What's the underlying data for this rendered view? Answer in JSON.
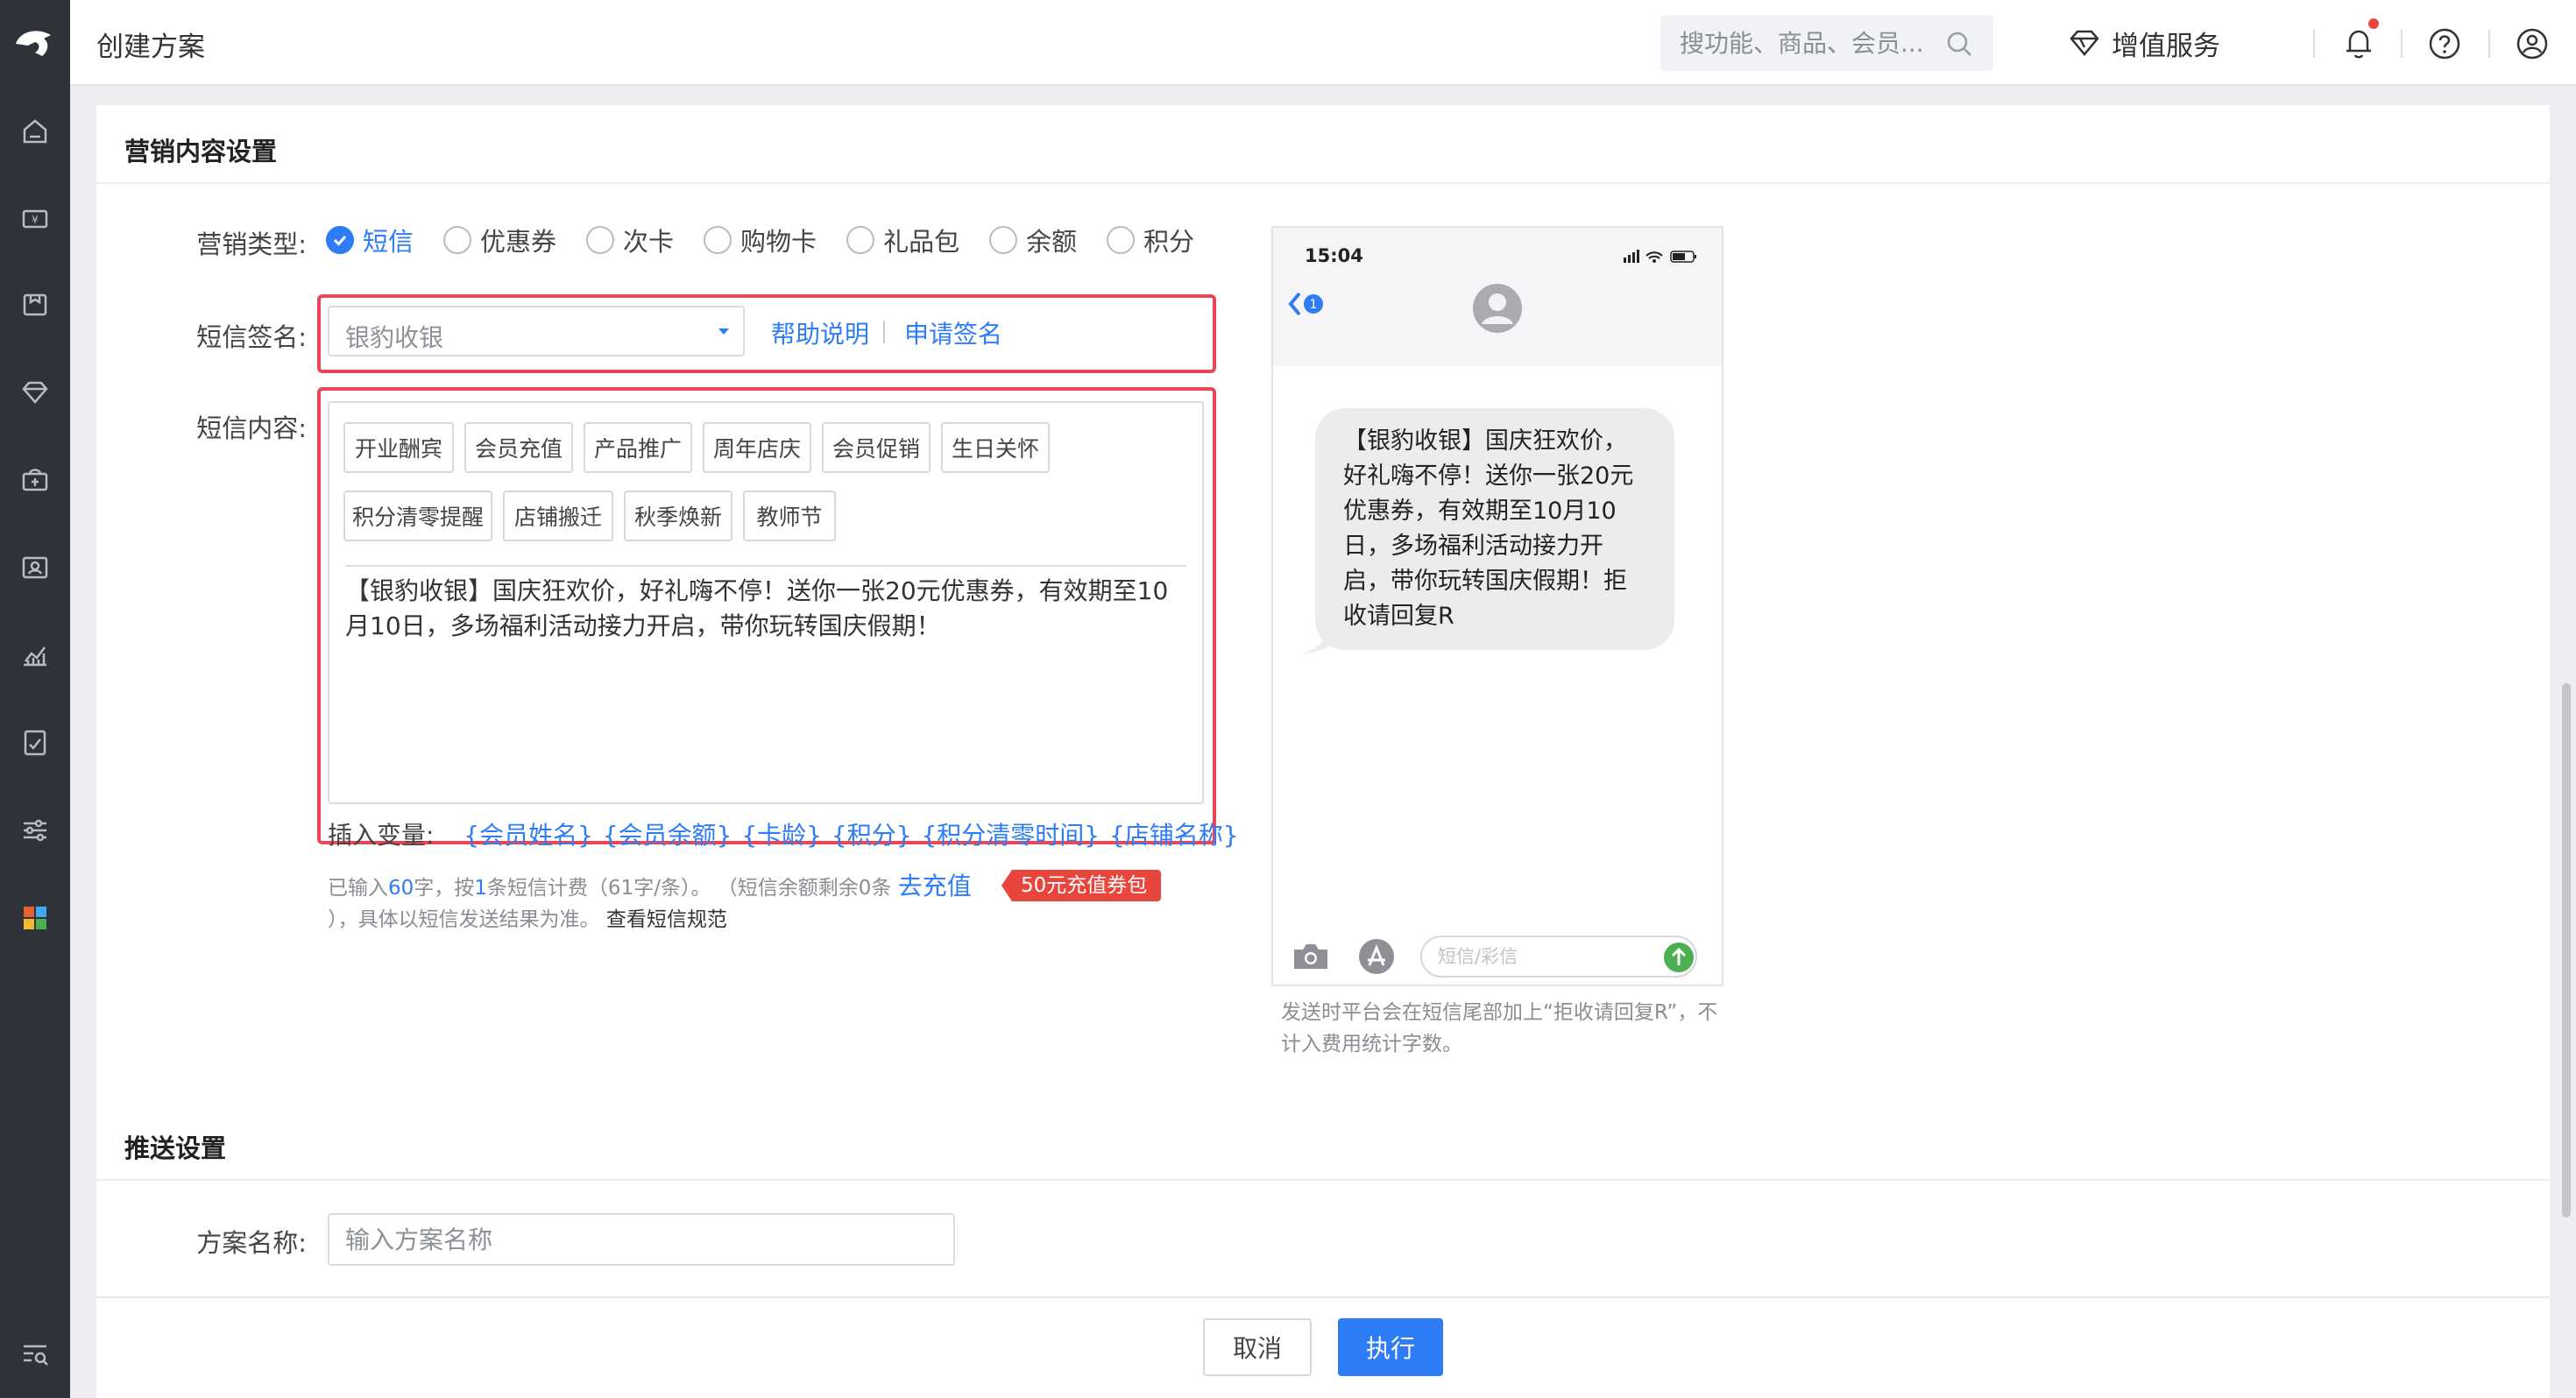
{
  "header": {
    "page_title": "创建方案",
    "search_placeholder": "搜功能、商品、会员...",
    "value_added_label": "增值服务"
  },
  "sidebar": {
    "items": [
      "home-icon",
      "cashier-icon",
      "goods-icon",
      "member-icon",
      "marketing-icon",
      "staff-icon",
      "report-icon",
      "finance-icon",
      "settings-icon",
      "apps-icon",
      "search-menu-icon"
    ]
  },
  "content": {
    "section_title": "营销内容设置",
    "marketing_type": {
      "label": "营销类型:",
      "options": [
        "短信",
        "优惠券",
        "次卡",
        "购物卡",
        "礼品包",
        "余额",
        "积分"
      ],
      "selected": "短信"
    },
    "signature": {
      "label": "短信签名:",
      "placeholder": "银豹收银",
      "help_link": "帮助说明",
      "apply_link": "申请签名"
    },
    "sms_content": {
      "label": "短信内容:",
      "templates_row1": [
        "开业酬宾",
        "会员充值",
        "产品推广",
        "周年店庆",
        "会员促销",
        "生日关怀"
      ],
      "templates_row2": [
        "积分清零提醒",
        "店铺搬迁",
        "秋季焕新",
        "教师节"
      ],
      "text": "【银豹收银】国庆狂欢价，好礼嗨不停！送你一张20元优惠券，有效期至10月10日，多场福利活动接力开启，带你玩转国庆假期！",
      "insert_label": "插入变量:",
      "variables": [
        "{会员姓名}",
        "{会员余额}",
        "{卡龄}",
        "{积分}",
        "{积分清零时间}",
        "{店铺名称}"
      ]
    },
    "stats": {
      "prefix": "已输入",
      "count": "60",
      "mid": "字，按",
      "sms_count": "1",
      "suffix": "条短信计费（61字/条）。 （短信余额剩余0条",
      "recharge_link": "去充值",
      "badge": "50元充值券包",
      "line2": "），具体以短信发送结果为准。",
      "rules_link": "查看短信规范"
    },
    "preview": {
      "time": "15:04",
      "back_badge": "1",
      "bubble": "【银豹收银】国庆狂欢价，好礼嗨不停！送你一张20元优惠券，有效期至10月10日，多场福利活动接力开启，带你玩转国庆假期！拒收请回复R",
      "input_placeholder": "短信/彩信",
      "note": "发送时平台会在短信尾部加上“拒收请回复R”，不计入费用统计字数。"
    },
    "push_section_title": "推送设置",
    "plan_name": {
      "label": "方案名称:",
      "placeholder": "输入方案名称"
    }
  },
  "footer": {
    "cancel_label": "取消",
    "execute_label": "执行"
  },
  "colors": {
    "accent": "#2e7cf6",
    "highlight_frame": "#e84856",
    "sidebar_bg": "#2f3238",
    "badge_bg": "#e8453c"
  }
}
